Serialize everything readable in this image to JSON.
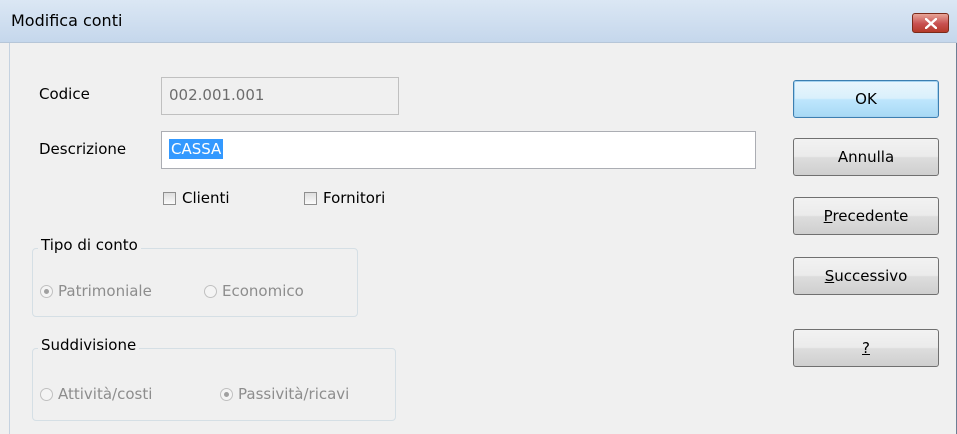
{
  "window": {
    "title": "Modifica conti"
  },
  "form": {
    "codice_label": "Codice",
    "codice_value": "002.001.001",
    "descrizione_label": "Descrizione",
    "descrizione_value": "CASSA",
    "clienti_label": "Clienti",
    "clienti_checked": false,
    "fornitori_label": "Fornitori",
    "fornitori_checked": false
  },
  "tipo_di_conto": {
    "legend": "Tipo di conto",
    "options": [
      {
        "label": "Patrimoniale",
        "selected": true
      },
      {
        "label": "Economico",
        "selected": false
      }
    ]
  },
  "suddivisione": {
    "legend": "Suddivisione",
    "options": [
      {
        "label": "Attività/costi",
        "selected": false
      },
      {
        "label": "Passività/ricavi",
        "selected": true
      }
    ]
  },
  "buttons": {
    "ok": "OK",
    "annulla": "Annulla",
    "precedente_mnemonic": "P",
    "precedente_rest": "recedente",
    "successivo_mnemonic": "S",
    "successivo_rest": "uccessivo",
    "help": "?"
  },
  "colors": {
    "selection": "#3399ff",
    "close": "#c75050"
  }
}
